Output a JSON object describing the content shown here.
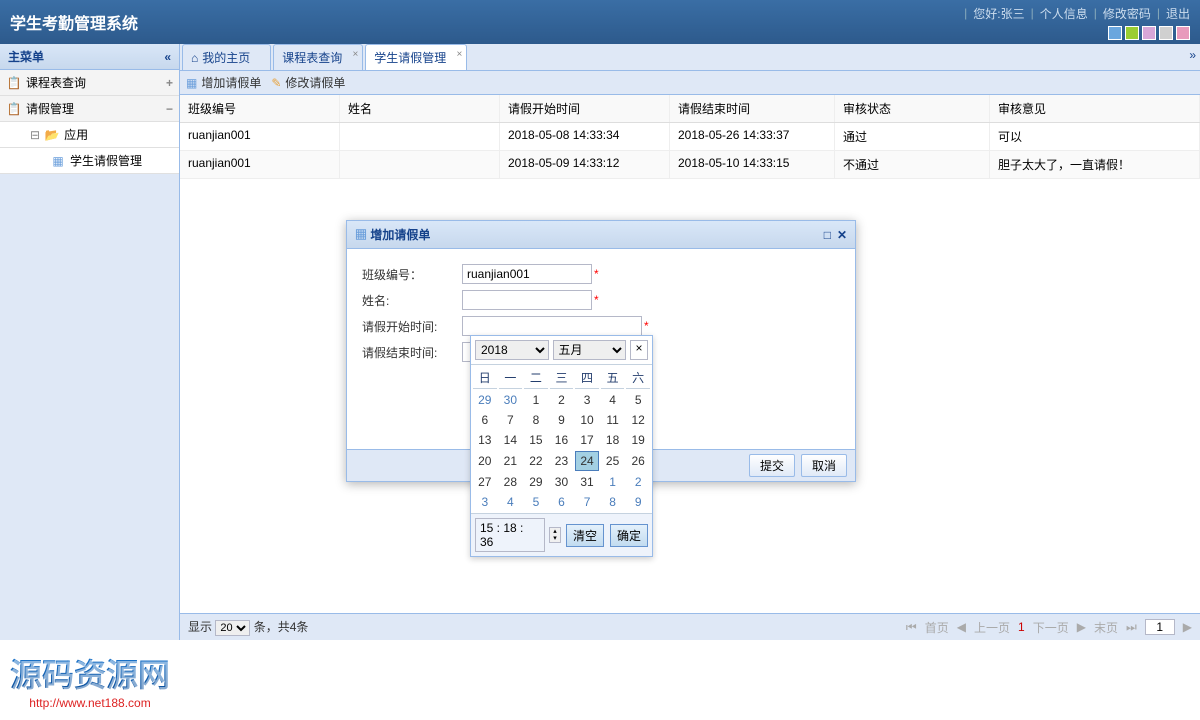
{
  "header": {
    "title": "学生考勤管理系统",
    "greeting": "您好:张三",
    "links": {
      "profile": "个人信息",
      "password": "修改密码",
      "logout": "退出"
    },
    "colors": [
      "#6aa6de",
      "#9acd32",
      "#d8a6d8",
      "#d0d0d0",
      "#e89abc"
    ]
  },
  "sidebar": {
    "title": "主菜单",
    "items": [
      {
        "label": "课程表查询",
        "action": "+"
      },
      {
        "label": "请假管理",
        "action": "−"
      }
    ],
    "tree": {
      "folder": "应用",
      "leaf": "学生请假管理"
    }
  },
  "tabs": {
    "items": [
      {
        "label": "我的主页",
        "closable": false,
        "active": false,
        "home": true
      },
      {
        "label": "课程表查询",
        "closable": true,
        "active": false
      },
      {
        "label": "学生请假管理",
        "closable": true,
        "active": true
      }
    ]
  },
  "toolbar": {
    "add": "增加请假单",
    "edit": "修改请假单"
  },
  "grid": {
    "headers": [
      "班级编号",
      "姓名",
      "请假开始时间",
      "请假结束时间",
      "审核状态",
      "审核意见"
    ],
    "rows": [
      [
        "ruanjian001",
        "",
        "2018-05-08 14:33:34",
        "2018-05-26 14:33:37",
        "通过",
        "可以"
      ],
      [
        "ruanjian001",
        "",
        "2018-05-09 14:33:12",
        "2018-05-10 14:33:15",
        "不通过",
        "胆子太大了，一直请假！"
      ]
    ]
  },
  "pager": {
    "show": "显示",
    "per_page": "20",
    "unit": "条，共4条",
    "first": "首页",
    "prev": "上一页",
    "page": "1",
    "next": "下一页",
    "last": "末页",
    "input": "1"
  },
  "dialog": {
    "title": "增加请假单",
    "fields": {
      "class_label": "班级编号：",
      "class_value": "ruanjian001",
      "name_label": "姓名:",
      "name_value": "",
      "start_label": "请假开始时间:",
      "start_value": "",
      "end_label": "请假结束时间:",
      "end_value": ""
    },
    "submit": "提交",
    "cancel": "取消"
  },
  "datepicker": {
    "year": "2018",
    "month": "五月",
    "weekdays": [
      "日",
      "一",
      "二",
      "三",
      "四",
      "五",
      "六"
    ],
    "weeks": [
      [
        {
          "d": "29",
          "o": 1
        },
        {
          "d": "30",
          "o": 1
        },
        {
          "d": "1"
        },
        {
          "d": "2"
        },
        {
          "d": "3"
        },
        {
          "d": "4"
        },
        {
          "d": "5"
        }
      ],
      [
        {
          "d": "6"
        },
        {
          "d": "7"
        },
        {
          "d": "8"
        },
        {
          "d": "9"
        },
        {
          "d": "10"
        },
        {
          "d": "11"
        },
        {
          "d": "12"
        }
      ],
      [
        {
          "d": "13"
        },
        {
          "d": "14"
        },
        {
          "d": "15"
        },
        {
          "d": "16"
        },
        {
          "d": "17"
        },
        {
          "d": "18"
        },
        {
          "d": "19"
        }
      ],
      [
        {
          "d": "20"
        },
        {
          "d": "21"
        },
        {
          "d": "22"
        },
        {
          "d": "23"
        },
        {
          "d": "24",
          "t": 1
        },
        {
          "d": "25"
        },
        {
          "d": "26"
        }
      ],
      [
        {
          "d": "27"
        },
        {
          "d": "28"
        },
        {
          "d": "29"
        },
        {
          "d": "30"
        },
        {
          "d": "31"
        },
        {
          "d": "1",
          "o": 1
        },
        {
          "d": "2",
          "o": 1
        }
      ],
      [
        {
          "d": "3",
          "o": 1
        },
        {
          "d": "4",
          "o": 1
        },
        {
          "d": "5",
          "o": 1
        },
        {
          "d": "6",
          "o": 1
        },
        {
          "d": "7",
          "o": 1
        },
        {
          "d": "8",
          "o": 1
        },
        {
          "d": "9",
          "o": 1
        }
      ]
    ],
    "time": "15 : 18 : 36",
    "clear": "清空",
    "ok": "确定",
    "close": "×"
  },
  "watermark": {
    "text": "源码资源网",
    "url": "http://www.net188.com"
  }
}
